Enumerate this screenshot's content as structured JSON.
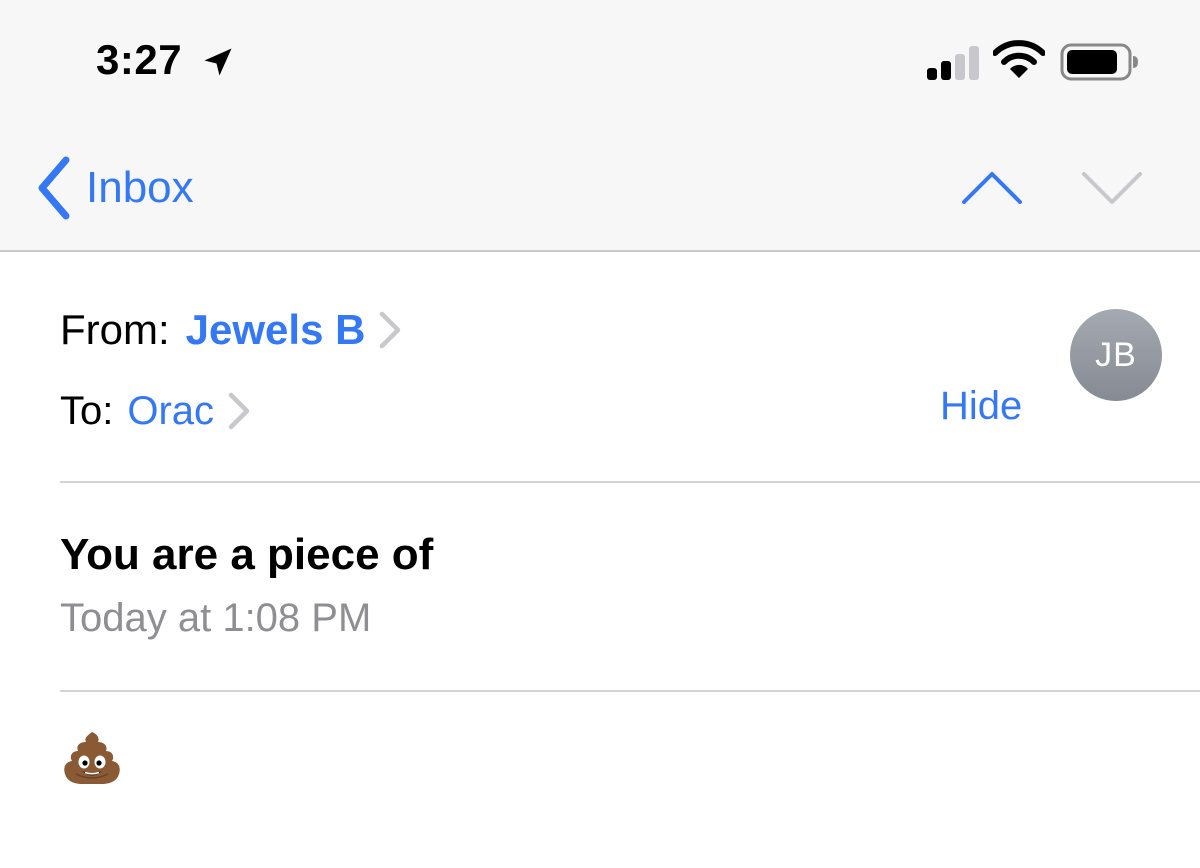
{
  "status_bar": {
    "time": "3:27",
    "icons": [
      "location-arrow-icon",
      "signal-bars-icon",
      "wifi-icon",
      "battery-icon"
    ]
  },
  "nav": {
    "back_label": "Inbox",
    "icons": [
      "chevron-left-icon",
      "chevron-up-icon",
      "chevron-down-icon"
    ]
  },
  "header": {
    "from_label": "From:",
    "from_name": "Jewels B",
    "to_label": "To:",
    "to_name": "Orac",
    "hide_label": "Hide",
    "avatar_initials": "JB"
  },
  "message": {
    "subject": "You are a piece of",
    "date": "Today at 1:08 PM",
    "body_icon": "poop-emoji-icon"
  },
  "colors": {
    "accent": "#3478f6",
    "secondary_text": "#8e8e93",
    "nav_background": "#f7f7f7",
    "avatar": "#8e939b"
  }
}
